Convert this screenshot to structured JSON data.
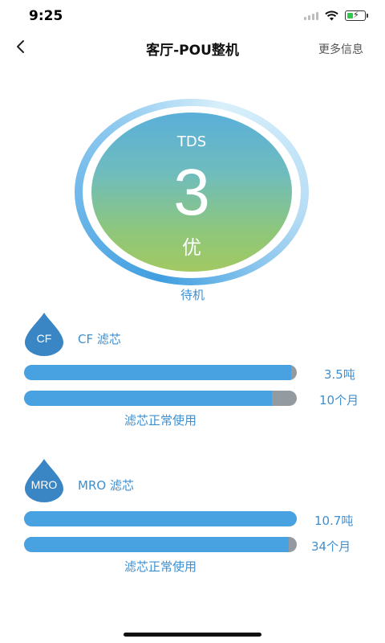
{
  "status_bar": {
    "time": "9:25",
    "battery_level": 0.35
  },
  "nav": {
    "title": "客厅-POU整机",
    "more_info_label": "更多信息"
  },
  "tds": {
    "label": "TDS",
    "value": "3",
    "quality": "优",
    "state": "待机"
  },
  "filters": [
    {
      "icon_label": "CF",
      "name": "CF 滤芯",
      "bars": [
        {
          "value": "3.5吨",
          "fill_fraction": 0.98
        },
        {
          "value": "10个月",
          "fill_fraction": 0.91
        }
      ],
      "status": "滤芯正常使用"
    },
    {
      "icon_label": "MRO",
      "name": "MRO 滤芯",
      "bars": [
        {
          "value": "10.7吨",
          "fill_fraction": 1.0
        },
        {
          "value": "34个月",
          "fill_fraction": 0.97
        }
      ],
      "status": "滤芯正常使用"
    }
  ],
  "colors": {
    "accent": "#3d8fd0",
    "bar_fill": "#48a1e0",
    "bar_track": "#939aa0"
  }
}
